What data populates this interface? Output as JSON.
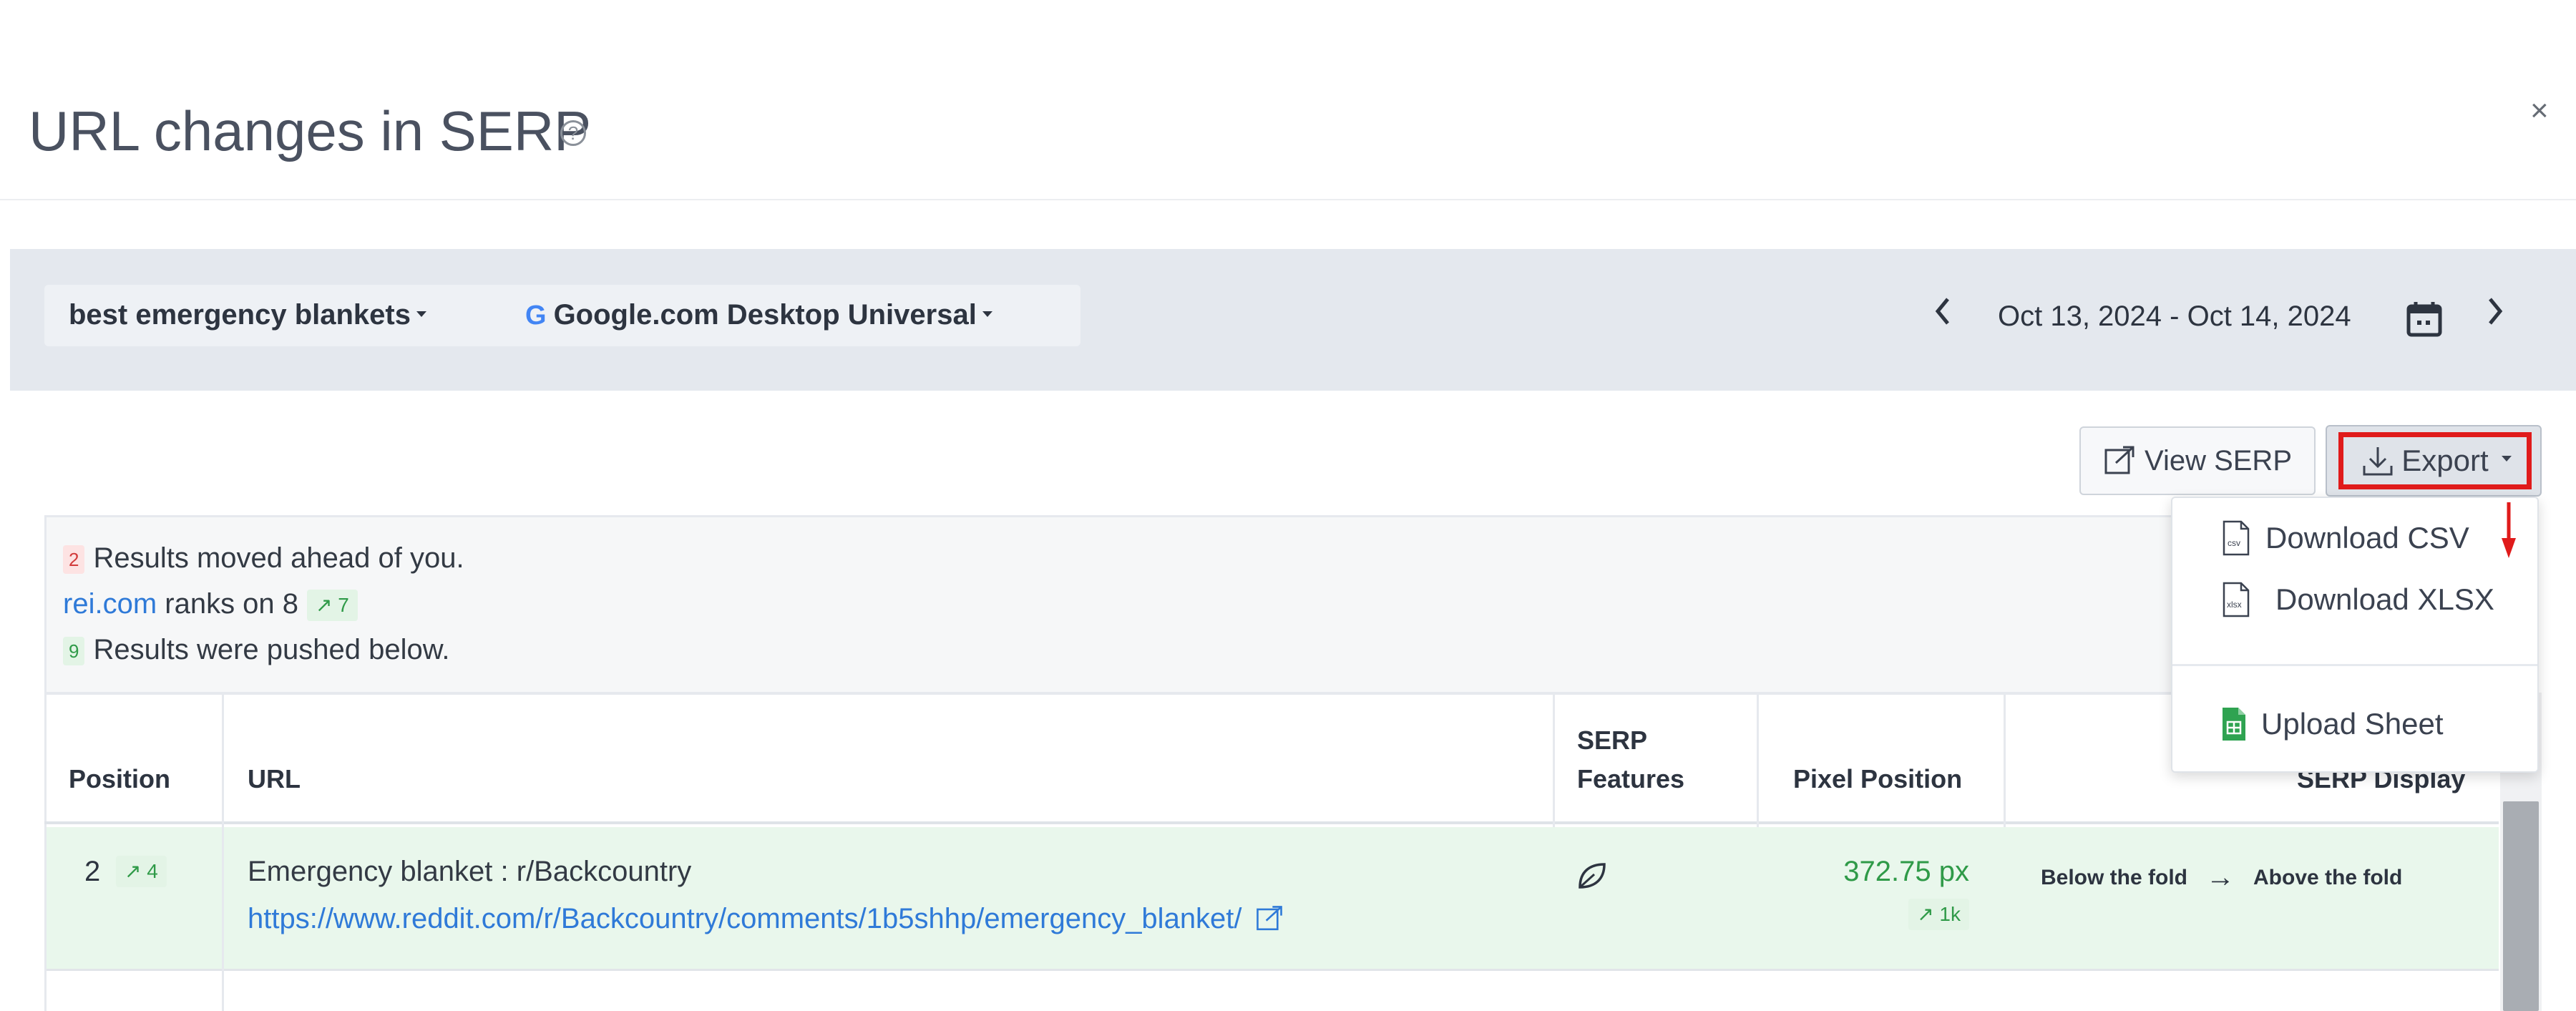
{
  "dialog": {
    "title": "URL changes in SERP",
    "help_glyph": "?",
    "close_glyph": "×"
  },
  "filters": {
    "keyword": "best emergency blankets",
    "engine_logo": "G",
    "engine": "Google.com Desktop Universal",
    "date_range": "Oct 13, 2024 - Oct 14, 2024",
    "prev_glyph": "‹",
    "next_glyph": "›"
  },
  "toolbar": {
    "view_serp_label": "View SERP",
    "export_label": "Export"
  },
  "export_menu": {
    "items": [
      {
        "label": "Download CSV",
        "icon": "csv-file-icon"
      },
      {
        "label": "Download XLSX",
        "icon": "xlsx-file-icon"
      },
      {
        "label": "Upload Sheet",
        "icon": "google-sheets-icon"
      }
    ]
  },
  "summary": {
    "ahead_count": "2",
    "ahead_text": "Results moved ahead of you.",
    "domain": "rei.com",
    "ranks_text": " ranks on 8",
    "rank_change": "↗ 7",
    "below_count": "9",
    "below_text": "Results were pushed below."
  },
  "table": {
    "headers": {
      "position": "Position",
      "url": "URL",
      "serp_features_line1": "SERP",
      "serp_features_line2": "Features",
      "pixel_position": "Pixel Position",
      "serp_display": "SERP Display"
    },
    "rows": [
      {
        "position": "2",
        "position_change": "↗ 4",
        "title": "Emergency blanket : r/Backcountry",
        "url": "https://www.reddit.com/r/Backcountry/comments/1b5shhp/emergency_blanket/",
        "feature_icon": "leaf-icon",
        "pixel_position": "372.75 px",
        "pixel_change": "↗ 1k",
        "display_from": "Below the fold",
        "display_arrow": "→",
        "display_to": "Above the fold"
      }
    ]
  },
  "colors": {
    "accent_red": "#e01b1b",
    "link_blue": "#2f7ad8",
    "positive_green": "#2f9a48",
    "row_highlight": "#e9f7ec"
  }
}
